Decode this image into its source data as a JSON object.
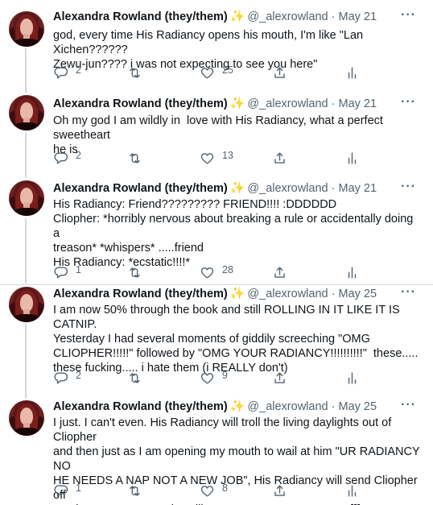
{
  "colors": {
    "text": "#0f1419",
    "secondary": "#536471",
    "divider": "#cfd9de",
    "sparkle": "#f5b400"
  },
  "icons": {
    "reply": "reply-icon",
    "retweet": "retweet-icon",
    "like": "heart-icon",
    "share": "share-icon",
    "analytics": "analytics-icon",
    "more": "more-icon"
  },
  "tweets": [
    {
      "author": "Alexandra Rowland (they/them)",
      "emoji": "✨",
      "handle": "@_alexrowland",
      "separator": "·",
      "date": "May 21",
      "text": "god, every time His Radiancy opens his mouth, I'm like \"Lan Xichen??????\nZewu-jun???? i was not expecting to see you here\"",
      "replies": "2",
      "retweets": "",
      "likes": "25"
    },
    {
      "author": "Alexandra Rowland (they/them)",
      "emoji": "✨",
      "handle": "@_alexrowland",
      "separator": "·",
      "date": "May 21",
      "text": "Oh my god I am wildly in  love with His Radiancy, what a perfect sweetheart\nhe is",
      "replies": "2",
      "retweets": "",
      "likes": "13"
    },
    {
      "author": "Alexandra Rowland (they/them)",
      "emoji": "✨",
      "handle": "@_alexrowland",
      "separator": "·",
      "date": "May 21",
      "text": "His Radiancy: Friend????????? FRIEND!!!! :DDDDDD\nCliopher: *horribly nervous about breaking a rule or accidentally doing a\ntreason* *whispers* .....friend\nHis Radiancy: *ecstatic!!!!*",
      "replies": "1",
      "retweets": "",
      "likes": "28"
    },
    {
      "author": "Alexandra Rowland (they/them)",
      "emoji": "✨",
      "handle": "@_alexrowland",
      "separator": "·",
      "date": "May 25",
      "text": "I am now 50% through the book and still ROLLING IN IT LIKE IT IS CATNIP.\nYesterday I had several moments of giddily screeching \"OMG\nCLIOPHER!!!!!\" followed by \"OMG YOUR RADIANCY!!!!!!!!!!\"  these.....\nthese fucking..... i hate them (i REALLY don't)",
      "replies": "2",
      "retweets": "",
      "likes": "9"
    },
    {
      "author": "Alexandra Rowland (they/them)",
      "emoji": "✨",
      "handle": "@_alexrowland",
      "separator": "·",
      "date": "May 25",
      "text": "I just. I can't even. His Radiancy will troll the living daylights out of Cliopher\nand then just as I am opening my mouth to wail at him \"UR RADIANCY NO\nHE NEEDS A NAP NOT A NEW JOB\", His Radiancy will send Cliopher off\nto take seven naps and I'm like \"....FINE THEN. GOOD >:[[[\"",
      "replies": "1",
      "retweets": "",
      "likes": "8"
    }
  ]
}
